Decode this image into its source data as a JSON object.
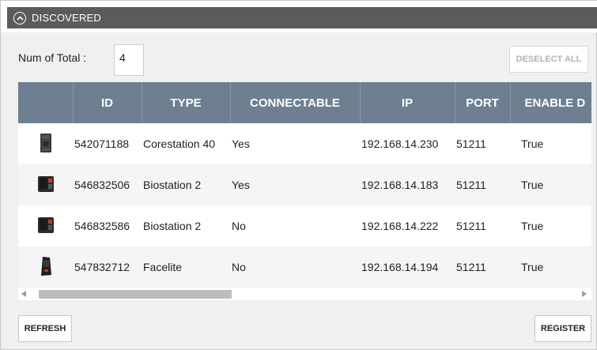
{
  "header": {
    "title": "DISCOVERED",
    "icon": "chevron-up-circle-icon"
  },
  "total": {
    "label": "Num of Total :",
    "value": "4"
  },
  "buttons": {
    "deselect_all": "DESELECT ALL",
    "refresh": "REFRESH",
    "register": "REGISTER"
  },
  "table": {
    "columns": [
      "",
      "ID",
      "TYPE",
      "CONNECTABLE",
      "IP",
      "PORT",
      "ENABLE D"
    ],
    "rows": [
      {
        "icon": "corestation-device-icon",
        "id": "542071188",
        "type": "Corestation 40",
        "connectable": "Yes",
        "ip": "192.168.14.230",
        "port": "51211",
        "enable": "True"
      },
      {
        "icon": "biostation-device-icon",
        "id": "546832506",
        "type": "Biostation 2",
        "connectable": "Yes",
        "ip": "192.168.14.183",
        "port": "51211",
        "enable": "True"
      },
      {
        "icon": "biostation-device-icon",
        "id": "546832586",
        "type": "Biostation 2",
        "connectable": "No",
        "ip": "192.168.14.222",
        "port": "51211",
        "enable": "True"
      },
      {
        "icon": "facelite-device-icon",
        "id": "547832712",
        "type": "Facelite",
        "connectable": "No",
        "ip": "192.168.14.194",
        "port": "51211",
        "enable": "True"
      }
    ]
  },
  "colors": {
    "header_bar": "#5d5a5a",
    "table_header": "#6d7f91",
    "panel_bg": "#f0f0f0"
  }
}
